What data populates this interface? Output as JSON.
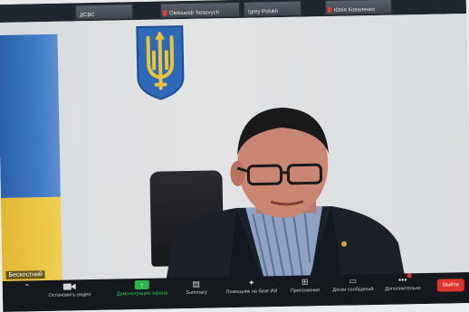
{
  "participants": [
    {
      "name": "ДСВС",
      "muted": false
    },
    {
      "name": "Oleksandr Sesevych",
      "muted": true
    },
    {
      "name": "Igrey Polukh",
      "muted": false
    },
    {
      "name": "Юлія Коваленко",
      "muted": true
    }
  ],
  "main_video": {
    "speaker_label": "Бескостний"
  },
  "toolbar": {
    "audio_label": "",
    "video_label": "Остановить видео",
    "share_label": "Демонстрация экрана",
    "summary_label": "Summary",
    "ai_label": "Помощник на базе ИИ",
    "apps_label": "Приложения",
    "whiteboard_label": "Доски сообщений",
    "more_label": "Дополнительно",
    "leave_label": "Выйти"
  },
  "colors": {
    "share_green": "#2fb34c",
    "leave_red": "#e0342e",
    "flag_blue": "#2b5fa8",
    "flag_yellow": "#f0cf52"
  }
}
